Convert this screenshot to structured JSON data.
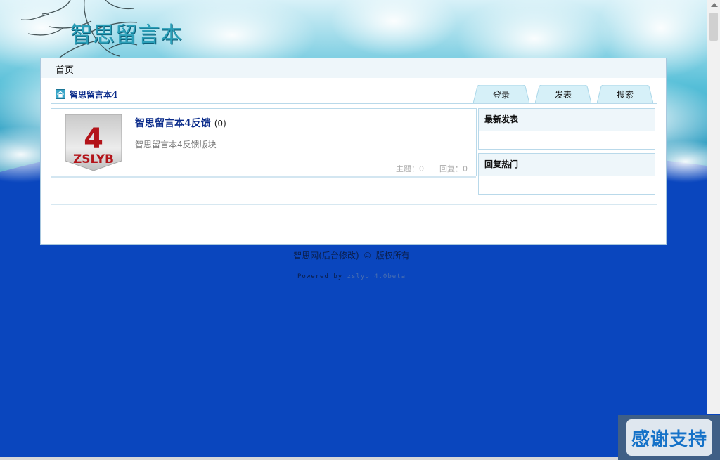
{
  "header": {
    "logo_text": "智思留言本"
  },
  "nav": {
    "home_label": "首页"
  },
  "breadcrumb": {
    "current": "智思留言本4"
  },
  "tabs": [
    {
      "label": "登录"
    },
    {
      "label": "发表"
    },
    {
      "label": "搜索"
    }
  ],
  "forum": {
    "logo_number": "4",
    "logo_text": "ZSLYB",
    "title": "智思留言本4反馈",
    "count": "(0)",
    "description": "智思留言本4反馈版块",
    "topics_label": "主题：",
    "topics_value": "0",
    "replies_label": "回复：",
    "replies_value": "0"
  },
  "sidebar": {
    "latest_title": "最新发表",
    "hot_title": "回复热门"
  },
  "footer": {
    "copyright_name": "智思网(后台修改)",
    "copyright_mark": "©",
    "copyright_text": "版权所有",
    "powered_prefix": "Powered by",
    "powered_version": "zslyb 4.0beta"
  },
  "badge": {
    "thanks_text": "感谢支持"
  },
  "colors": {
    "page_blue": "#0a46be",
    "title_navy": "#0a2b8a",
    "panel_border": "#b9d9ea",
    "logo_red": "#b3141a"
  }
}
